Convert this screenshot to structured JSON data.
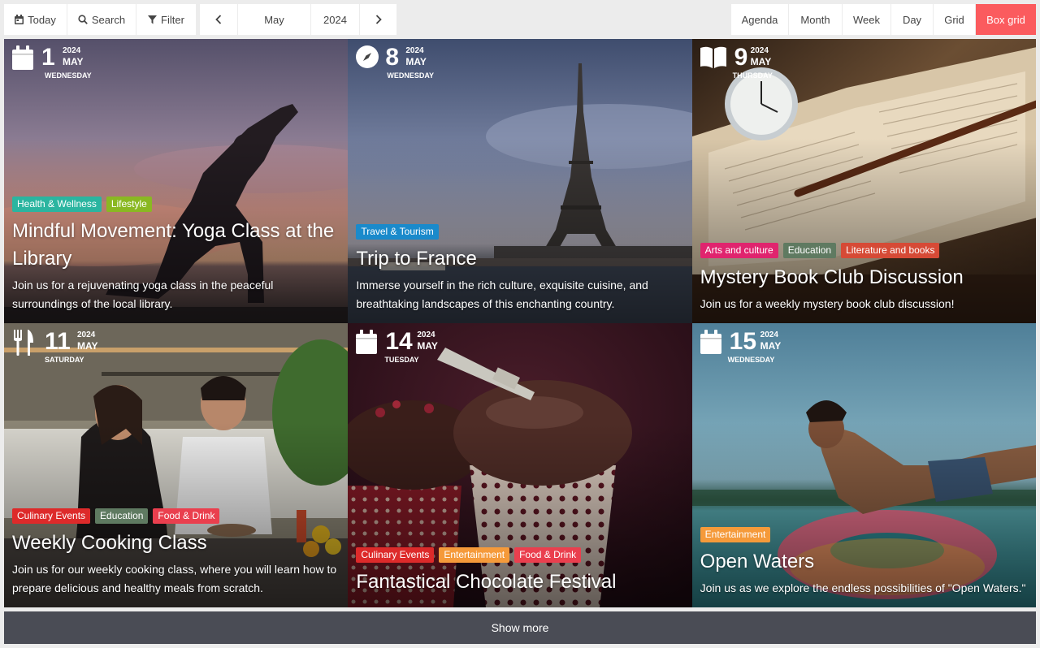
{
  "toolbar": {
    "today": "Today",
    "search": "Search",
    "filter": "Filter",
    "month": "May",
    "year": "2024",
    "views": [
      "Agenda",
      "Month",
      "Week",
      "Day",
      "Grid",
      "Box grid"
    ],
    "active_view": "Box grid"
  },
  "tag_colors": {
    "Health & Wellness": "#2bb5a0",
    "Lifestyle": "#8ab822",
    "Travel & Tourism": "#1a8acb",
    "Arts and culture": "#e0246e",
    "Education": "#5f7a61",
    "Literature and books": "#d64a36",
    "Culinary Events": "#dd2a2a",
    "Food & Drink": "#ea3f4e",
    "Entertainment": "#f59a3a"
  },
  "events": [
    {
      "day": "1",
      "year": "2024",
      "month": "MAY",
      "weekday": "WEDNESDAY",
      "icon": "calendar-icon",
      "tags": [
        "Health & Wellness",
        "Lifestyle"
      ],
      "title": "Mindful Movement: Yoga Class at the Library",
      "description": "Join us for a rejuvenating yoga class in the peaceful surroundings of the local library."
    },
    {
      "day": "8",
      "year": "2024",
      "month": "MAY",
      "weekday": "WEDNESDAY",
      "icon": "compass-icon",
      "tags": [
        "Travel & Tourism"
      ],
      "title": "Trip to France",
      "description": "Immerse yourself in the rich culture, exquisite cuisine, and breathtaking landscapes of this enchanting country."
    },
    {
      "day": "9",
      "year": "2024",
      "month": "MAY",
      "weekday": "THURSDAY",
      "icon": "book-icon",
      "tags": [
        "Arts and culture",
        "Education",
        "Literature and books"
      ],
      "title": "Mystery Book Club Discussion",
      "description": "Join us for a weekly mystery book club discussion!"
    },
    {
      "day": "11",
      "year": "2024",
      "month": "MAY",
      "weekday": "SATURDAY",
      "icon": "utensils-icon",
      "tags": [
        "Culinary Events",
        "Education",
        "Food & Drink"
      ],
      "title": "Weekly Cooking Class",
      "description": "Join us for our weekly cooking class, where you will learn how to prepare delicious and healthy meals from scratch."
    },
    {
      "day": "14",
      "year": "2024",
      "month": "MAY",
      "weekday": "TUESDAY",
      "icon": "calendar-icon",
      "tags": [
        "Culinary Events",
        "Entertainment",
        "Food & Drink"
      ],
      "title": "Fantastical Chocolate Festival",
      "description": ""
    },
    {
      "day": "15",
      "year": "2024",
      "month": "MAY",
      "weekday": "WEDNESDAY",
      "icon": "calendar-icon",
      "tags": [
        "Entertainment"
      ],
      "title": "Open Waters",
      "description": "Join us as we explore the endless possibilities of \"Open Waters.\""
    }
  ],
  "show_more": "Show more"
}
